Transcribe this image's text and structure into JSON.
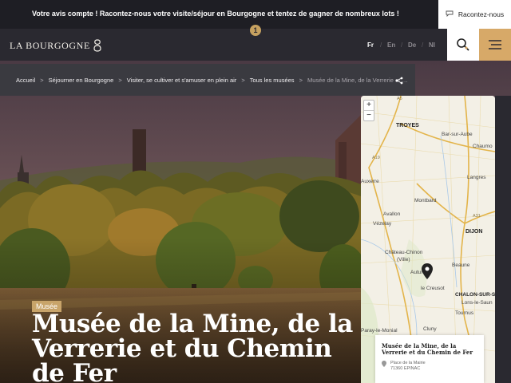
{
  "topbar": {
    "message": "Votre avis compte ! Racontez-nous votre visite/séjour en Bourgogne et tentez de gagner de nombreux lots !",
    "cta_label": "Racontez-nous",
    "badge": "1"
  },
  "header": {
    "logo_text": "LA BOURGOGNE",
    "languages": [
      "Fr",
      "En",
      "De",
      "Nl"
    ],
    "active_language": "Fr",
    "accent_color": "#d7a968"
  },
  "breadcrumb": {
    "items": [
      "Accueil",
      "Séjourner en Bourgogne",
      "Visiter, se cultiver et s'amuser en plein air",
      "Tous les musées"
    ],
    "current": "Musée de la Mine, de la Verrerie et du Chemin de Fer"
  },
  "hero": {
    "category": "Musée",
    "title": "Musée de la Mine, de la Verrerie et du Chemin de Fer"
  },
  "map": {
    "zoom_in": "+",
    "zoom_out": "−",
    "labels": {
      "troyes": "TROYES",
      "bar_sur_aube": "Bar-sur-Aube",
      "chaumont": "Chaumo",
      "langres": "Langres",
      "auxerre": "Auxerre",
      "montbard": "Montbard",
      "avallon": "Avallon",
      "vezelay": "Vézelay",
      "dijon": "DIJON",
      "chateau_chinon": "Château-Chinon",
      "ville": "(Ville)",
      "beaune": "Beaune",
      "autun": "Autun",
      "le_creusot": "le Creusot",
      "chalon": "CHALON-SUR-SA",
      "lons": "Lons-le-Saun",
      "tournus": "Tournus",
      "paray": "Paray-le-Monial",
      "cluny": "Cluny",
      "a5": "A5",
      "a6": "A6",
      "a31": "A31",
      "a26": "A26",
      "a38": "A38",
      "a39": "A39",
      "a77": "A77",
      "a19": "A19",
      "n7": "N7"
    },
    "popup": {
      "name": "Musée de la Mine, de la Verrerie et du Chemin de Fer",
      "street": "Place de la Mairie",
      "city": "71360 EPINAC"
    }
  }
}
